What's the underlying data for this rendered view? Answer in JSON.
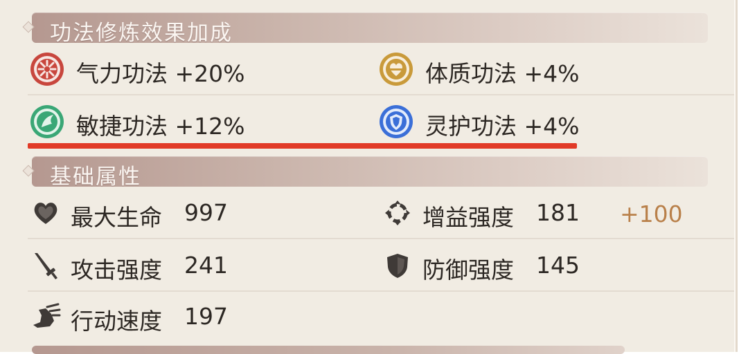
{
  "cultivation_section": {
    "title": "功法修炼效果加成",
    "items": [
      {
        "label": "气力功法 +20%",
        "icon": "strength-technique-icon",
        "color": "#c8463d"
      },
      {
        "label": "体质功法 +4%",
        "icon": "constitution-technique-icon",
        "color": "#c99a3a"
      },
      {
        "label": "敏捷功法 +12%",
        "icon": "agility-technique-icon",
        "color": "#3aa776"
      },
      {
        "label": "灵护功法 +4%",
        "icon": "spirit-guard-technique-icon",
        "color": "#3b6fd8"
      }
    ]
  },
  "base_section": {
    "title": "基础属性",
    "stats": [
      {
        "label": "最大生命",
        "value": "997",
        "icon": "heart-icon"
      },
      {
        "label": "增益强度",
        "value": "181",
        "icon": "buff-ring-icon",
        "bonus": "+100"
      },
      {
        "label": "攻击强度",
        "value": "241",
        "icon": "sword-icon"
      },
      {
        "label": "防御强度",
        "value": "145",
        "icon": "shield-icon"
      },
      {
        "label": "行动速度",
        "value": "197",
        "icon": "speed-boot-icon"
      }
    ]
  },
  "colors": {
    "highlight_underline": "#e13a27",
    "bonus_text": "#b9804a"
  }
}
